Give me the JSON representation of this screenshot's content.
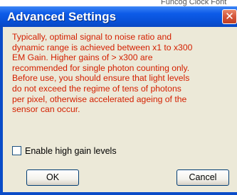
{
  "background": {
    "window_text": "Funcog Clock Font"
  },
  "dialog": {
    "title": "Advanced Settings",
    "close_glyph": "✕",
    "message": "Typically, optimal signal to noise ratio and\ndynamic range is achieved between x1 to x300\nEM Gain. Higher gains of > x300 are\nrecommended for single photon counting only.\nBefore use, you should ensure that light levels\ndo not exceed the regime of tens of photons\nper pixel, otherwise accelerated ageing of the\nsensor can occur.",
    "checkbox_label": "Enable high gain levels",
    "checkbox_checked": false,
    "ok_label": "OK",
    "cancel_label": "Cancel"
  },
  "colors": {
    "title_bar": "#0a4cc8",
    "message_text": "#d42000",
    "client_area": "#ece9d8",
    "close_button": "#d4553a"
  },
  "icons": {
    "close": "close-icon"
  }
}
